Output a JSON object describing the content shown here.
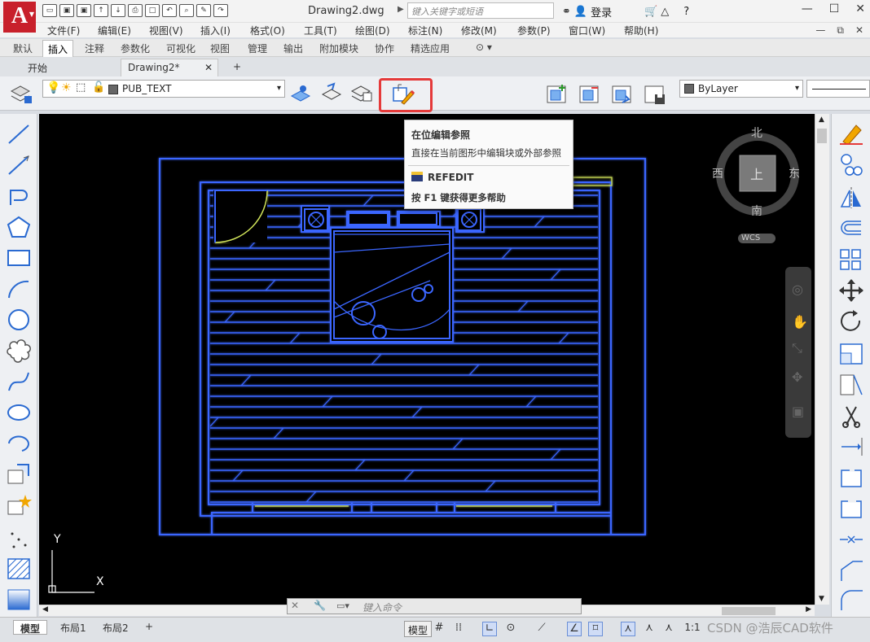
{
  "app": {
    "logo_letter": "A",
    "document_title": "Drawing2.dwg",
    "search_placeholder": "键入关键字或短语",
    "login_label": "登录"
  },
  "menu": [
    "文件(F)",
    "编辑(E)",
    "视图(V)",
    "插入(I)",
    "格式(O)",
    "工具(T)",
    "绘图(D)",
    "标注(N)",
    "修改(M)",
    "参数(P)",
    "窗口(W)",
    "帮助(H)"
  ],
  "ribbon_tabs": [
    "默认",
    "插入",
    "注释",
    "参数化",
    "可视化",
    "视图",
    "管理",
    "输出",
    "附加模块",
    "协作",
    "精选应用"
  ],
  "ribbon_active_tab": "插入",
  "file_tabs": [
    {
      "label": "开始"
    },
    {
      "label": "Drawing2*"
    }
  ],
  "layer_name": "PUB_TEXT",
  "color_combo": "ByLayer",
  "tooltip": {
    "title": "在位编辑参照",
    "description": "直接在当前图形中编辑块或外部参照",
    "command": "REFEDIT",
    "help": "按 F1 键获得更多帮助"
  },
  "viewcube": {
    "north": "北",
    "south": "南",
    "east": "东",
    "west": "西",
    "face": "上",
    "wcs": "WCS"
  },
  "ucs": {
    "x": "X",
    "y": "Y"
  },
  "command_placeholder": "键入命令",
  "layout_tabs": [
    "模型",
    "布局1",
    "布局2"
  ],
  "status": {
    "model": "模型",
    "scale": "1:1",
    "watermark": "CSDN @浩辰CAD软件"
  },
  "colors": {
    "canvas": "#000000",
    "drawing_line": "#2f5bff",
    "highlight_box": "#e53a3a",
    "logo_red": "#c8202b"
  }
}
